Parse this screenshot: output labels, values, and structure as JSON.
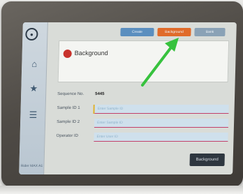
{
  "sidebar": {
    "user_text": "Rider\nMAX A1"
  },
  "tabs": [
    {
      "label": "Create"
    },
    {
      "label": "Background"
    },
    {
      "label": "Bank"
    }
  ],
  "panel": {
    "title": "Background"
  },
  "form": {
    "sequence_label": "Sequence No.",
    "sequence_value": "5445",
    "sample1_label": "Sample ID 1",
    "sample1_placeholder": "Enter Sample ID",
    "sample2_label": "Sample ID 2",
    "sample2_placeholder": "Enter Sample ID",
    "operator_label": "Operator ID",
    "operator_placeholder": "Enter User ID"
  },
  "footer": {
    "primary_label": "Background"
  },
  "colors": {
    "accent_orange": "#e06b2a",
    "tab_blue": "#5b8fbf",
    "arrow_green": "#37c23e",
    "status_red": "#c8322c"
  },
  "icons": {
    "top": "circle-dot-icon",
    "chart": "chart-icon",
    "favorite": "star-icon",
    "menu": "list-icon"
  }
}
